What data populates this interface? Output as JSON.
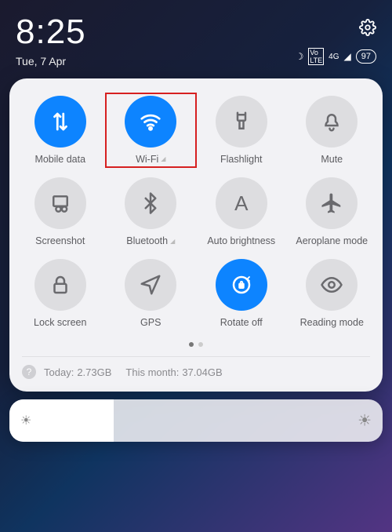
{
  "status": {
    "time": "8:25",
    "date": "Tue, 7 Apr",
    "network_type": "4G",
    "battery": "97",
    "dnd_glyph": "☽"
  },
  "tiles": {
    "mobile_data": {
      "label": "Mobile data",
      "active": true
    },
    "wifi": {
      "label": "Wi-Fi",
      "active": true
    },
    "flashlight": {
      "label": "Flashlight",
      "active": false
    },
    "mute": {
      "label": "Mute",
      "active": false
    },
    "screenshot": {
      "label": "Screenshot",
      "active": false
    },
    "bluetooth": {
      "label": "Bluetooth",
      "active": false
    },
    "auto_bright": {
      "label": "Auto brightness",
      "active": false
    },
    "airplane": {
      "label": "Aeroplane mode",
      "active": false
    },
    "lock": {
      "label": "Lock screen",
      "active": false
    },
    "gps": {
      "label": "GPS",
      "active": false
    },
    "rotate": {
      "label": "Rotate off",
      "active": true
    },
    "reading": {
      "label": "Reading mode",
      "active": false
    }
  },
  "usage": {
    "today_label": "Today:",
    "today_value": "2.73GB",
    "month_label": "This month:",
    "month_value": "37.04GB"
  }
}
